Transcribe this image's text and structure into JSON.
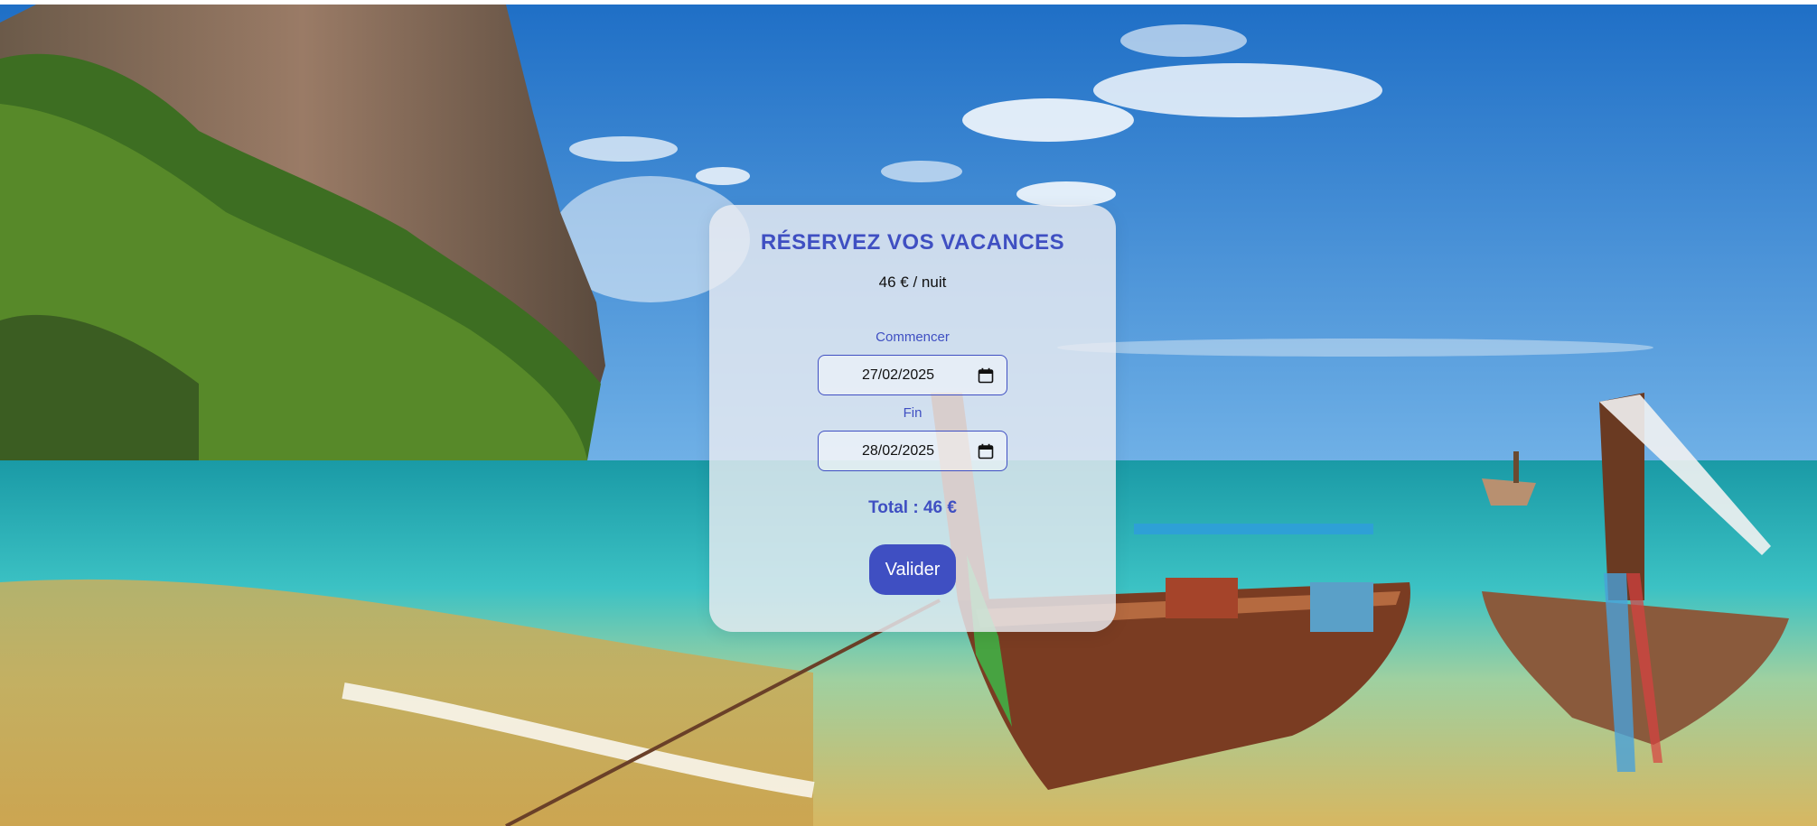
{
  "booking": {
    "title": "RÉSERVEZ VOS VACANCES",
    "price_per_night": "46 € / nuit",
    "start_label": "Commencer",
    "start_value": "27/02/2025",
    "end_label": "Fin",
    "end_value": "28/02/2025",
    "total": "Total : 46 €",
    "submit_label": "Valider"
  },
  "colors": {
    "accent": "#3f4fc2",
    "card_background": "#e9ecf2",
    "sky": "#2f7fd0",
    "sea": "#2fb3c6",
    "sand": "#d9bd6a"
  },
  "icons": {
    "date_picker": "calendar-icon"
  }
}
